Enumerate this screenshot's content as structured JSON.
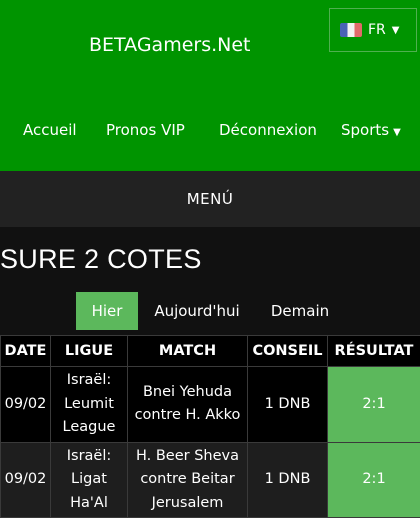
{
  "header": {
    "brand": "BETAGamers.Net",
    "language": "FR",
    "nav": [
      "Accueil",
      "Pronos VIP",
      "Déconnexion",
      "Sports"
    ]
  },
  "menu_label": "MENÚ",
  "page_title": "SURE 2 COTES",
  "tabs": [
    "Hier",
    "Aujourd'hui",
    "Demain"
  ],
  "table": {
    "columns": [
      "DATE",
      "LIGUE",
      "MATCH",
      "CONSEIL",
      "RÉSULTAT"
    ],
    "rows": [
      {
        "date": "09/02",
        "league": "Israël: Leumit League",
        "match": "Bnei Yehuda contre H. Akko",
        "advice": "1 DNB",
        "result": "2:1"
      },
      {
        "date": "09/02",
        "league": "Israël: Ligat Ha'Al",
        "match": "H. Beer Sheva contre Beitar Jerusalem",
        "advice": "1 DNB",
        "result": "2:1"
      }
    ]
  },
  "colors": {
    "header_green": "#009400",
    "accent_green": "#5cb85c",
    "menu_bar": "#222222"
  }
}
